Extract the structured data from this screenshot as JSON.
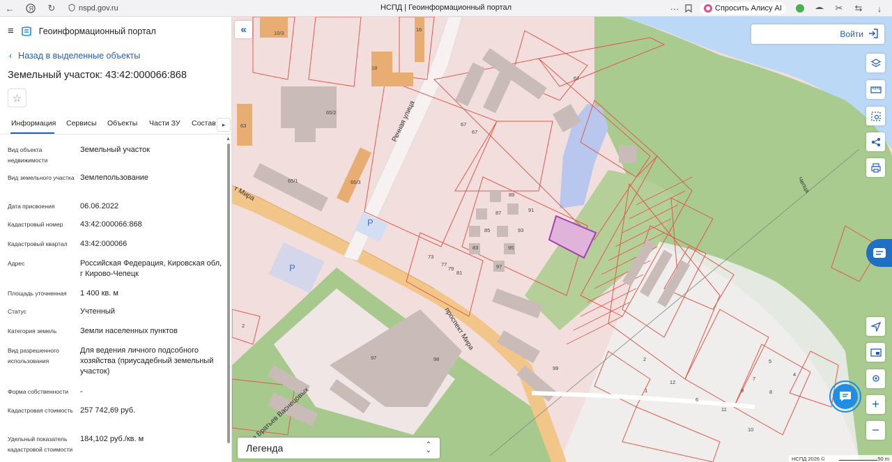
{
  "browser": {
    "url": "nspd.gov.ru",
    "title": "НСПД | Геоинформационный портал",
    "alisa_label": "Спросить Алису AI"
  },
  "portal": {
    "name": "Геоинформационный портал",
    "back_label": "Назад в выделенные объекты",
    "object_title": "Земельный участок: 43:42:000066:868"
  },
  "tabs": [
    {
      "label": "Информация",
      "active": true
    },
    {
      "label": "Сервисы",
      "active": false
    },
    {
      "label": "Объекты",
      "active": false
    },
    {
      "label": "Части ЗУ",
      "active": false
    },
    {
      "label": "Состав",
      "active": false
    }
  ],
  "info": [
    {
      "label": "Вид объекта недвижимости",
      "value": "Земельный участок"
    },
    {
      "label": "Вид земельного участка",
      "value": "Землепользование"
    },
    {
      "label": "Дата присвоения",
      "value": "06.06.2022"
    },
    {
      "label": "Кадастровый номер",
      "value": "43:42:000066:868"
    },
    {
      "label": "Кадастровый квартал",
      "value": "43:42:000066"
    },
    {
      "label": "Адрес",
      "value": "Российская Федерация, Кировская обл, г Кирово-Чепецк"
    },
    {
      "label": "Площадь уточненная",
      "value": "1 400 кв. м"
    },
    {
      "label": "Статус",
      "value": "Учтенный"
    },
    {
      "label": "Категория земель",
      "value": "Земли населенных пунктов"
    },
    {
      "label": "Вид разрешенного использования",
      "value": "Для ведения личного подсобного хозяйства (приусадебный земельный участок)"
    },
    {
      "label": "Форма собственности",
      "value": "-"
    },
    {
      "label": "Кадастровая стоимость",
      "value": "257 742,69 руб."
    },
    {
      "label": "Удельный показатель кадастровой стоимости",
      "value": "184,102 руб./кв. м"
    }
  ],
  "map": {
    "login_label": "Войти",
    "legend_label": "Легенда",
    "copyright": "НСПД 2026 ©",
    "scale": "50 m",
    "streets": {
      "rechnaya": "Речная улица",
      "mira_top": "т Мира",
      "prospekt": "проспект Мира",
      "bratyev": "лица Братьев Васнецовых",
      "river": "Чепца"
    },
    "labels": [
      "10/3",
      "16",
      "18",
      "67",
      "65/2",
      "63",
      "67",
      "67",
      "65/1",
      "65/3",
      "89",
      "91",
      "87",
      "85",
      "93",
      "83",
      "95",
      "73",
      "77",
      "79",
      "81",
      "97",
      "2",
      "97",
      "98",
      "99",
      "2",
      "12",
      "7",
      "5",
      "1",
      "6",
      "9",
      "8",
      "4",
      "11",
      "10"
    ],
    "parking": "P"
  },
  "colors": {
    "accent": "#1f5ebd",
    "selected_parcel": "#e0b4da",
    "parcel_stroke": "#e05a4a",
    "water": "#bcd8f7",
    "green": "#a7c98e",
    "road": "#f2c588"
  }
}
